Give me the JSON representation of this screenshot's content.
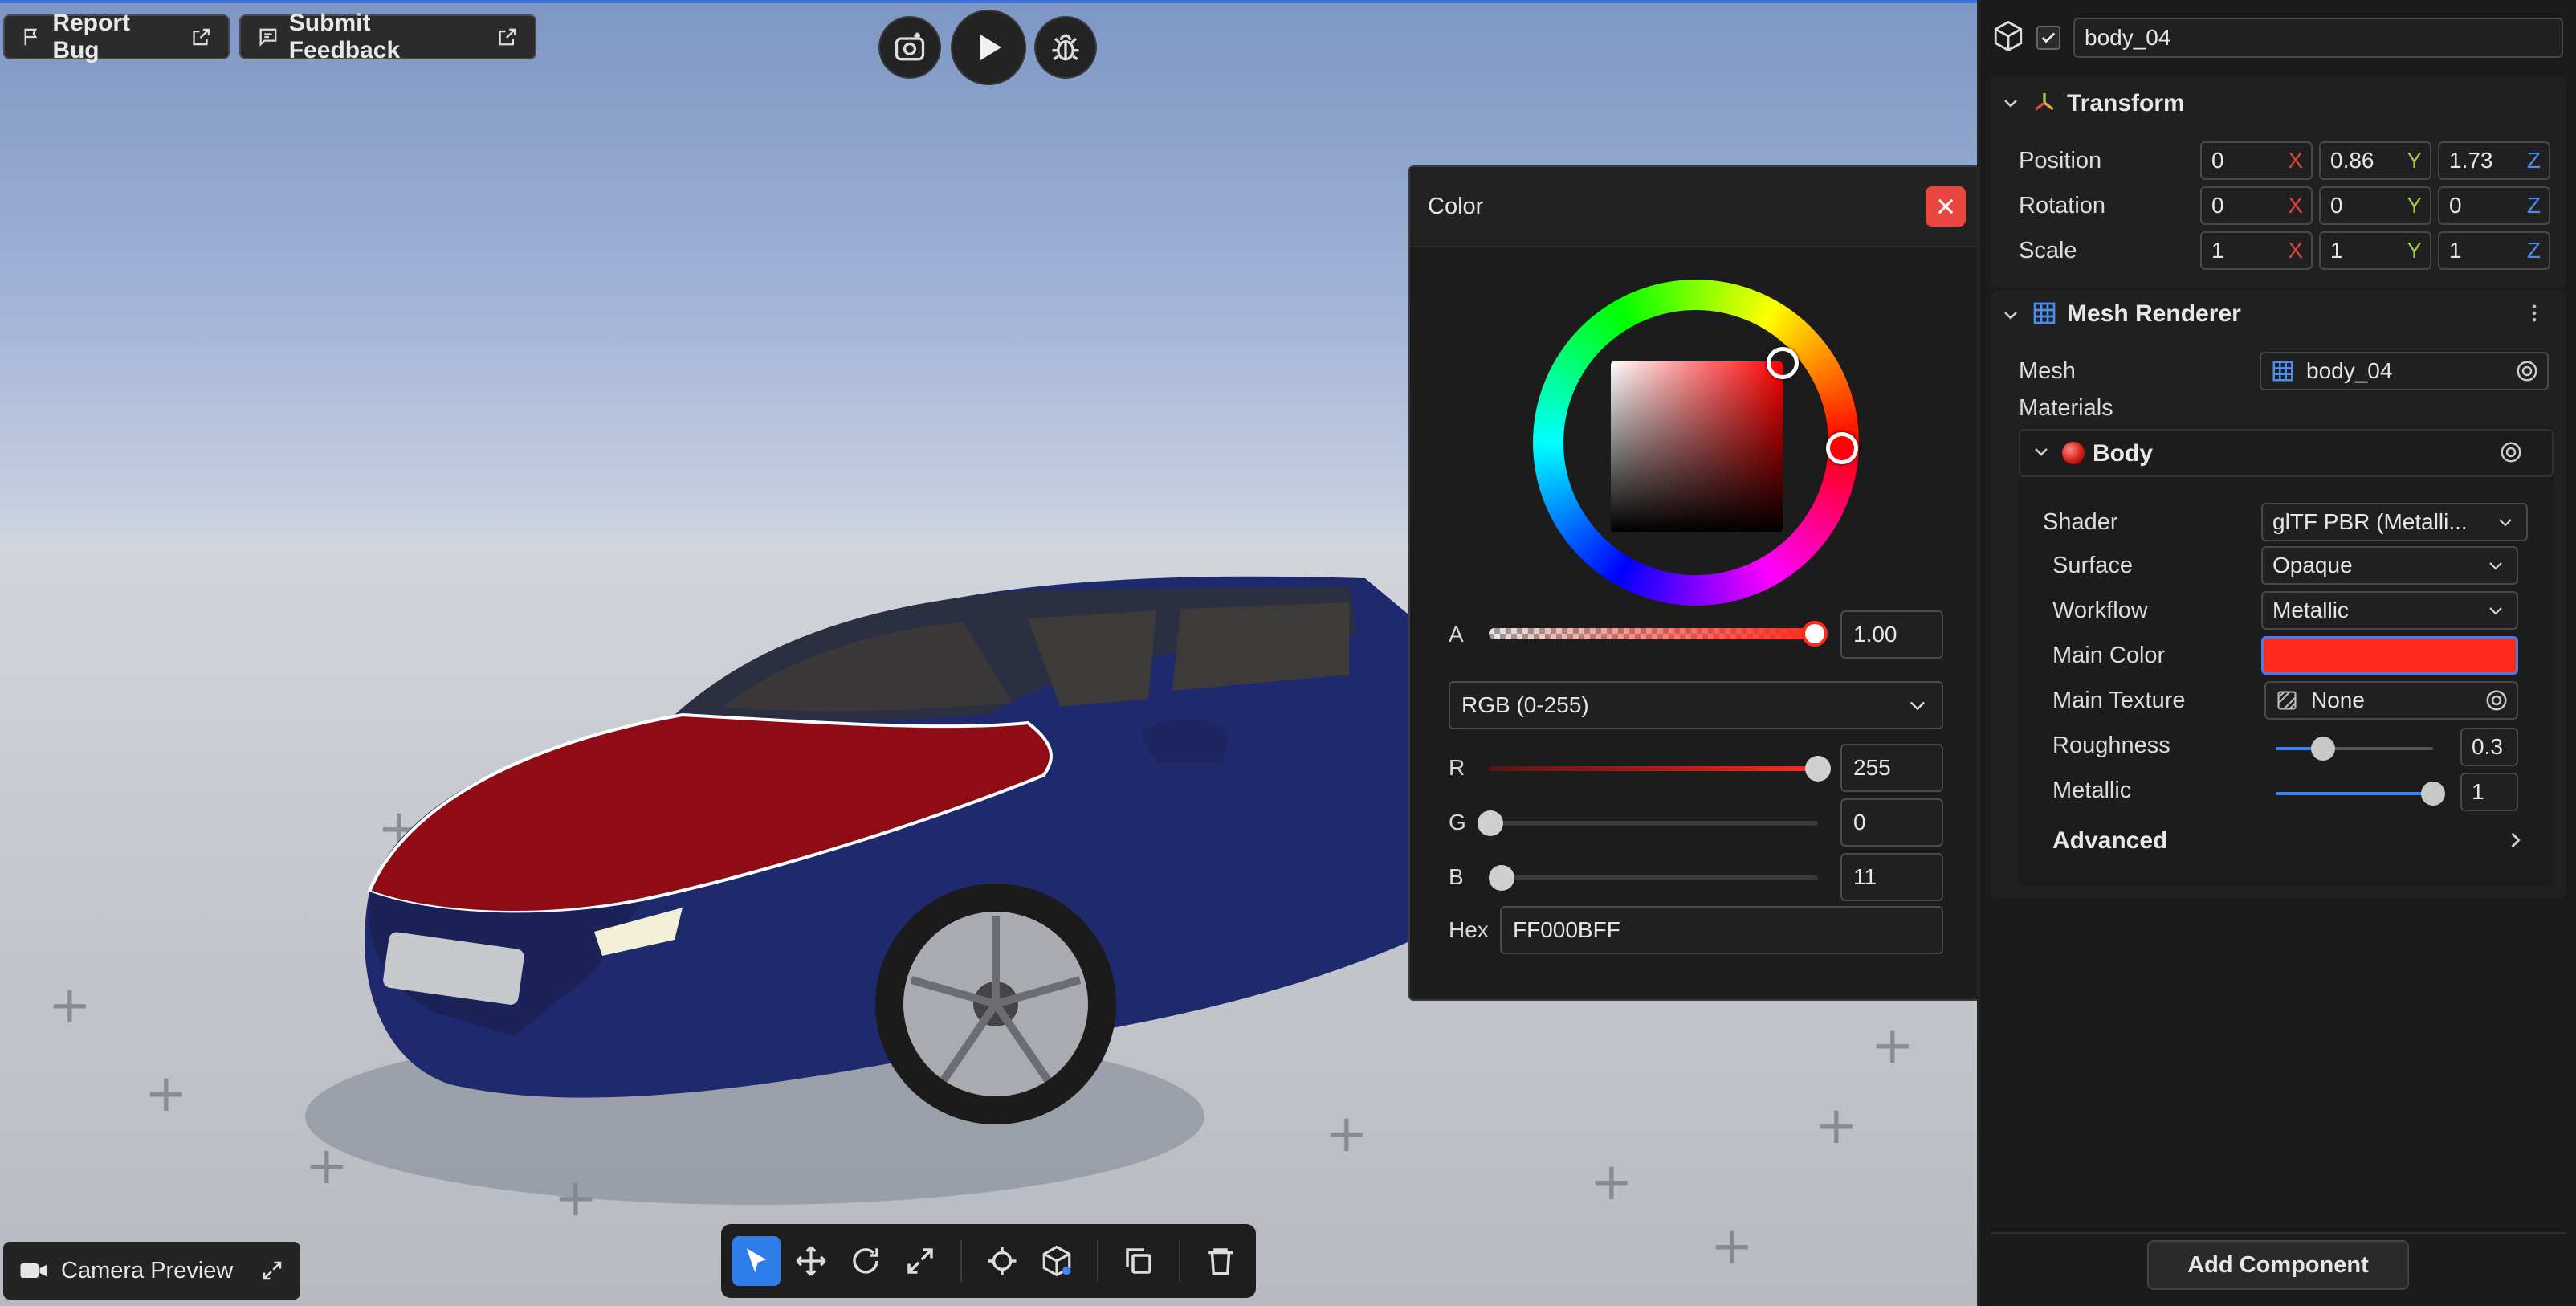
{
  "toolbar_top": {
    "report_bug": "Report Bug",
    "submit_feedback": "Submit Feedback"
  },
  "camera_preview": {
    "label": "Camera Preview"
  },
  "color_dialog": {
    "title": "Color",
    "alpha_label": "A",
    "alpha_value": "1.00",
    "mode": "RGB (0-255)",
    "r_label": "R",
    "r_value": "255",
    "g_label": "G",
    "g_value": "0",
    "b_label": "B",
    "b_value": "11",
    "hex_label": "Hex",
    "hex_value": "FF000BFF",
    "rgb": [
      255,
      0,
      11
    ],
    "alpha": 1.0
  },
  "inspector": {
    "object_name": "body_04",
    "transform": {
      "title": "Transform",
      "position": {
        "label": "Position",
        "x": "0",
        "y": "0.86",
        "z": "1.73"
      },
      "rotation": {
        "label": "Rotation",
        "x": "0",
        "y": "0",
        "z": "0"
      },
      "scale": {
        "label": "Scale",
        "x": "1",
        "y": "1",
        "z": "1"
      },
      "axis_x": "X",
      "axis_y": "Y",
      "axis_z": "Z"
    },
    "mesh_renderer": {
      "title": "Mesh Renderer",
      "mesh_label": "Mesh",
      "mesh_value": "body_04",
      "materials_label": "Materials",
      "material_name": "Body",
      "shader_label": "Shader",
      "shader_value": "glTF PBR (Metalli...",
      "surface_label": "Surface",
      "surface_value": "Opaque",
      "workflow_label": "Workflow",
      "workflow_value": "Metallic",
      "main_color_label": "Main Color",
      "main_texture_label": "Main Texture",
      "main_texture_value": "None",
      "roughness_label": "Roughness",
      "roughness_value": "0.3",
      "roughness": 0.3,
      "metallic_label": "Metallic",
      "metallic_value": "1",
      "metallic": 1.0,
      "advanced_label": "Advanced"
    },
    "add_component": "Add Component"
  },
  "colors": {
    "accent": "#3b82f6",
    "main_color": "#ff2a1a",
    "axis_x": "#e2453a",
    "axis_y": "#a3c94a",
    "axis_z": "#4a8ff0"
  }
}
